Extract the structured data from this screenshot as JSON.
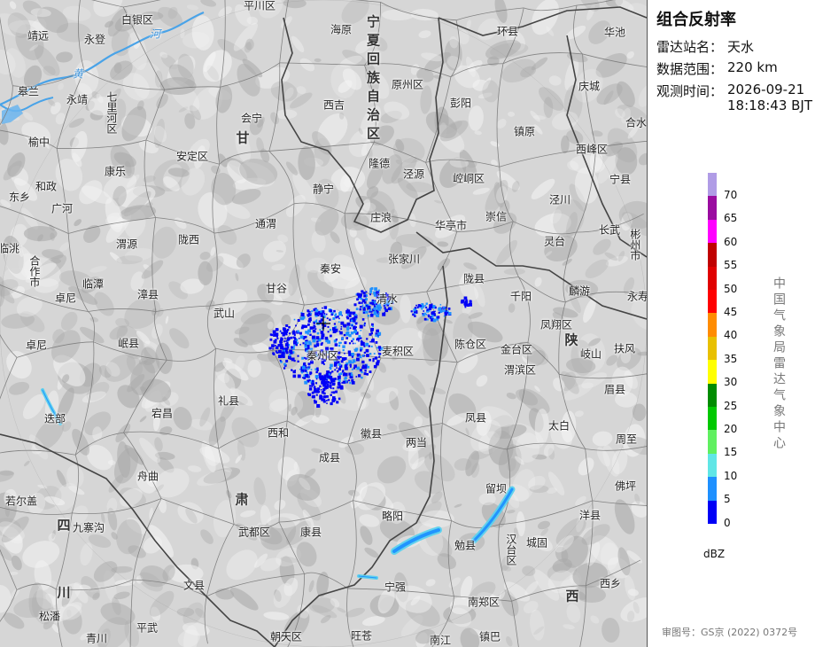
{
  "panel": {
    "title": "组合反射率",
    "rows": [
      {
        "key": "雷达站名：",
        "value": "天水"
      },
      {
        "key": "数据范围：",
        "value": "220 km"
      },
      {
        "key": "观测时间：",
        "value": "2026-09-21 18:18:43 BJT",
        "value_line1": "2026-09-21",
        "value_line2": "18:18:43 BJT"
      }
    ],
    "legend": {
      "levels": [
        {
          "value": 70,
          "label": "70",
          "color": "#b09ce6"
        },
        {
          "value": 65,
          "label": "65",
          "color": "#9a0ca0"
        },
        {
          "value": 60,
          "label": "60",
          "color": "#ff00ff"
        },
        {
          "value": 55,
          "label": "55",
          "color": "#c00000"
        },
        {
          "value": 50,
          "label": "50",
          "color": "#e00000"
        },
        {
          "value": 45,
          "label": "45",
          "color": "#ff0000"
        },
        {
          "value": 40,
          "label": "40",
          "color": "#ff8c00"
        },
        {
          "value": 35,
          "label": "35",
          "color": "#e8c000"
        },
        {
          "value": 30,
          "label": "30",
          "color": "#ffff00"
        },
        {
          "value": 25,
          "label": "25",
          "color": "#008c00"
        },
        {
          "value": 20,
          "label": "20",
          "color": "#00c800"
        },
        {
          "value": 15,
          "label": "15",
          "color": "#60f060"
        },
        {
          "value": 10,
          "label": "10",
          "color": "#60e6e6"
        },
        {
          "value": 5,
          "label": "5",
          "color": "#1e90ff"
        },
        {
          "value": 0,
          "label": "0",
          "color": "#0000f6"
        }
      ],
      "unit": "dBZ"
    },
    "org": "中国气象局雷达气象中心",
    "approval": "审图号：GS京 (2022) 0372号"
  },
  "map": {
    "provinces": [
      {
        "name": "宁夏回族自治区",
        "vertical": true
      },
      {
        "name": "甘"
      },
      {
        "name": "肃"
      },
      {
        "name": "陕"
      },
      {
        "name": "西"
      },
      {
        "name": "四"
      },
      {
        "name": "川"
      }
    ],
    "rivers": [
      "河",
      "黄"
    ],
    "places": [
      "平川区",
      "白银区",
      "靖远",
      "永登",
      "皋兰",
      "永靖",
      "七里河区",
      "榆中",
      "东乡",
      "和政",
      "广河",
      "康乐",
      "临洮",
      "合作市",
      "卓尼",
      "临潭",
      "渭源",
      "漳县",
      "岷县",
      "卓尼",
      "迭部",
      "海原",
      "西吉",
      "原州区",
      "彭阳",
      "环县",
      "华池",
      "庆城",
      "镇原",
      "西峰区",
      "合水",
      "会宁",
      "安定区",
      "隆德",
      "泾源",
      "崆峒区",
      "静宁",
      "通渭",
      "庄浪",
      "华亭市",
      "崇信",
      "泾川",
      "宁县",
      "陇西",
      "秦安",
      "张家川",
      "灵台",
      "长武",
      "彬州市",
      "甘谷",
      "秦州区",
      "麦积区",
      "清水",
      "陇县",
      "千阳",
      "麟游",
      "永寿",
      "武山",
      "陈仓区",
      "金台区",
      "渭滨区",
      "凤翔区",
      "岐山",
      "扶风",
      "礼县",
      "宕昌",
      "西和",
      "徽县",
      "两当",
      "凤县",
      "太白",
      "眉县",
      "周至",
      "舟曲",
      "成县",
      "留坝",
      "佛坪",
      "若尔盖",
      "九寨沟",
      "武都区",
      "康县",
      "略阳",
      "勉县",
      "汉台区",
      "城固",
      "洋县",
      "文县",
      "宁强",
      "南郑区",
      "西乡",
      "松潘",
      "平武",
      "青川",
      "朝天区",
      "旺苍",
      "南江",
      "镇巴"
    ],
    "radar_center": "天水"
  }
}
